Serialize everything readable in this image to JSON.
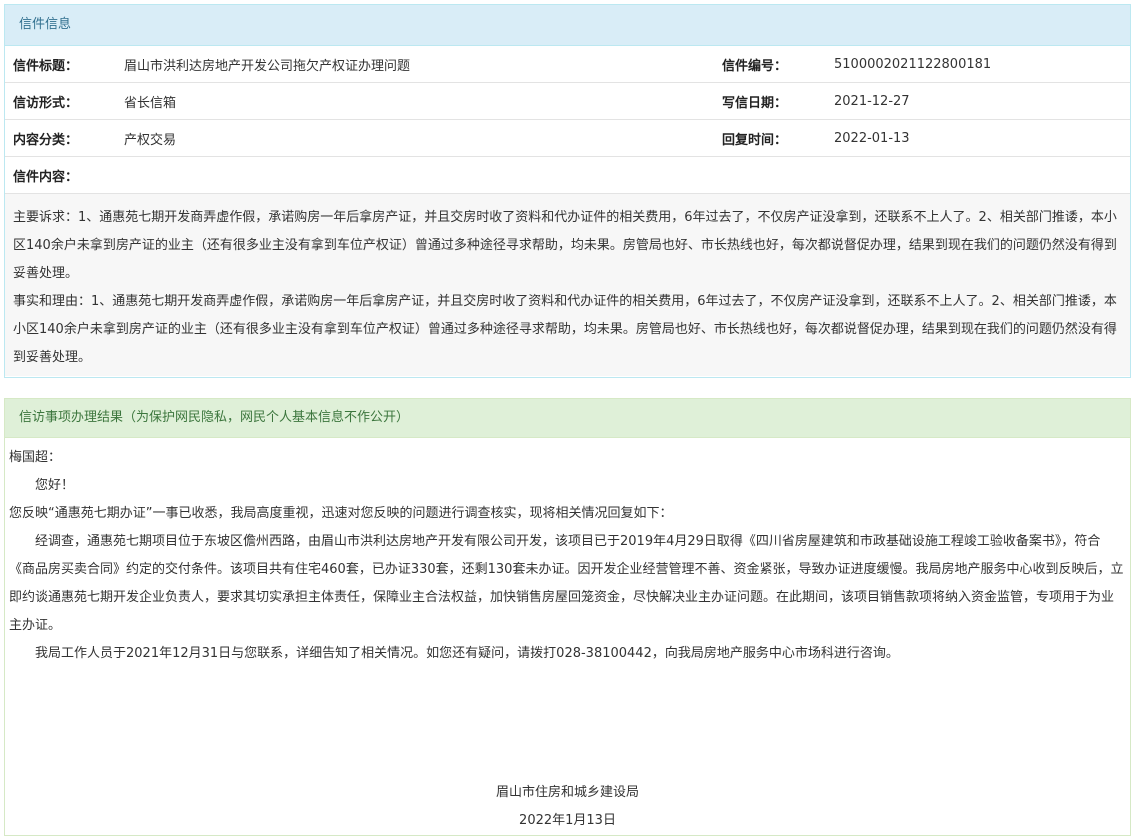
{
  "letter_panel": {
    "heading": "信件信息",
    "rows": [
      {
        "label1": "信件标题：",
        "value1": "眉山市洪利达房地产开发公司拖欠产权证办理问题",
        "label2": "信件编号：",
        "value2": "5100002021122800181"
      },
      {
        "label1": "信访形式：",
        "value1": "省长信箱",
        "label2": "写信日期：",
        "value2": "2021-12-27"
      },
      {
        "label1": "内容分类：",
        "value1": "产权交易",
        "label2": "回复时间：",
        "value2": "2022-01-13"
      }
    ],
    "content_label": "信件内容：",
    "content": [
      "主要诉求：1、通惠苑七期开发商弄虚作假，承诺购房一年后拿房产证，并且交房时收了资料和代办证件的相关费用，6年过去了，不仅房产证没拿到，还联系不上人了。2、相关部门推诿，本小区140余户未拿到房产证的业主（还有很多业主没有拿到车位产权证）曾通过多种途径寻求帮助，均未果。房管局也好、市长热线也好，每次都说督促办理，结果到现在我们的问题仍然没有得到妥善处理。",
      "事实和理由：1、通惠苑七期开发商弄虚作假，承诺购房一年后拿房产证，并且交房时收了资料和代办证件的相关费用，6年过去了，不仅房产证没拿到，还联系不上人了。2、相关部门推诿，本小区140余户未拿到房产证的业主（还有很多业主没有拿到车位产权证）曾通过多种途径寻求帮助，均未果。房管局也好、市长热线也好，每次都说督促办理，结果到现在我们的问题仍然没有得到妥善处理。"
    ]
  },
  "result_panel": {
    "heading": "信访事项办理结果（为保护网民隐私，网民个人基本信息不作公开）",
    "greeting_name": "梅国超：",
    "greeting": "您好！",
    "paragraphs": [
      "您反映“通惠苑七期办证”一事已收悉，我局高度重视，迅速对您反映的问题进行调查核实，现将相关情况回复如下：",
      "经调查，通惠苑七期项目位于东坡区儋州西路，由眉山市洪利达房地产开发有限公司开发，该项目已于2019年4月29日取得《四川省房屋建筑和市政基础设施工程竣工验收备案书》，符合《商品房买卖合同》约定的交付条件。该项目共有住宅460套，已办证330套，还剩130套未办证。因开发企业经营管理不善、资金紧张，导致办证进度缓慢。我局房地产服务中心收到反映后，立即约谈通惠苑七期开发企业负责人，要求其切实承担主体责任，保障业主合法权益，加快销售房屋回笼资金，尽快解决业主办证问题。在此期间，该项目销售款项将纳入资金监管，专项用于为业主办证。",
      "我局工作人员于2021年12月31日与您联系，详细告知了相关情况。如您还有疑问，请拨打028-38100442，向我局房地产服务中心市场科进行咨询。"
    ],
    "signature_org": "眉山市住房和城乡建设局",
    "signature_date": "2022年1月13日"
  }
}
